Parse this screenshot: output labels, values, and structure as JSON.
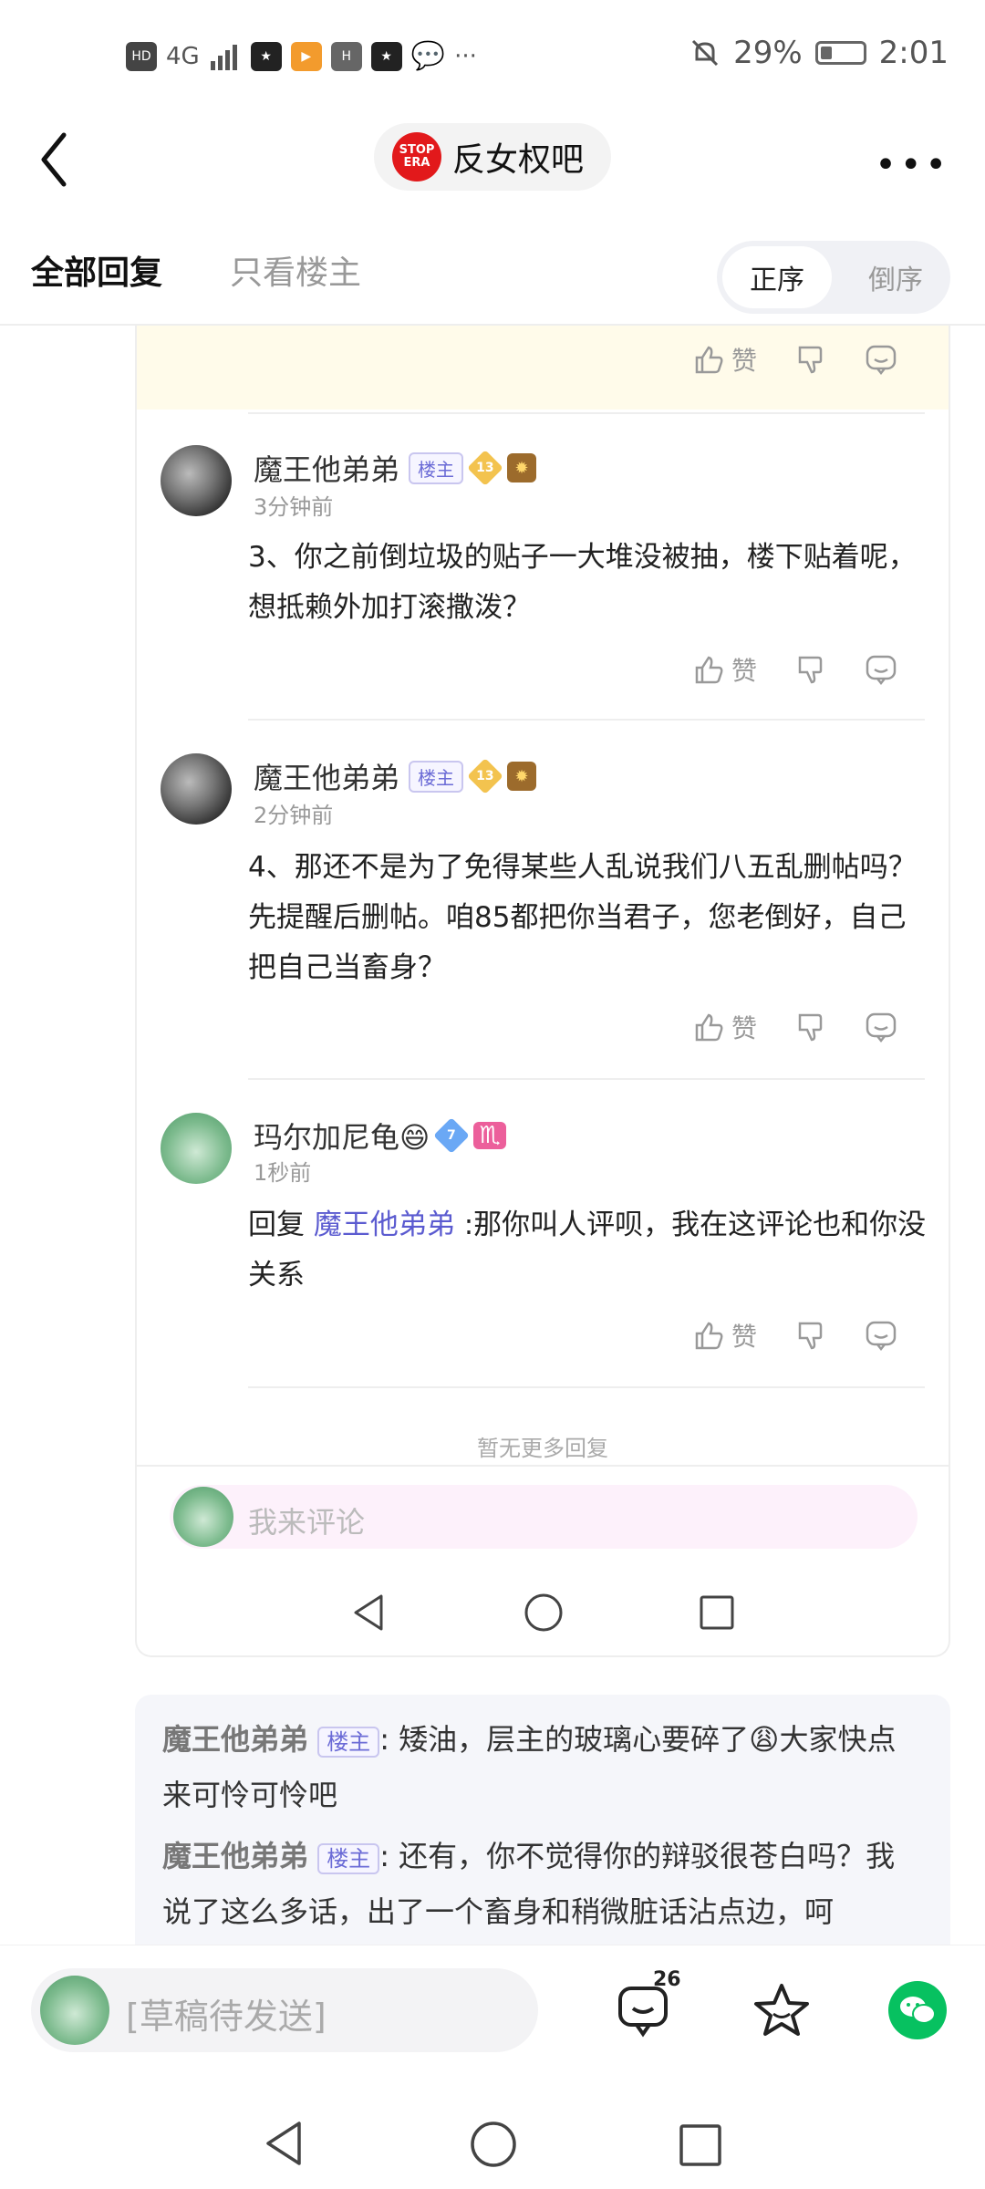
{
  "status_bar": {
    "left_text": "HD",
    "network": "4G",
    "battery_percent": "29%",
    "battery_level": 0.29,
    "time": "2:01",
    "more": "···"
  },
  "header": {
    "forum_logo_line1": "STOP",
    "forum_logo_line2": "ERA",
    "forum_name": "反女权吧",
    "more": "•••"
  },
  "tabs": {
    "all": "全部回复",
    "owner_only": "只看楼主",
    "order_asc": "正序",
    "order_desc": "倒序"
  },
  "actions": {
    "like": "赞"
  },
  "replies": [
    {
      "username": "魔王他弟弟",
      "owner_badge": "楼主",
      "level": "13",
      "time": "3分钟前",
      "content": "3、你之前倒垃圾的贴子一大堆没被抽，楼下贴着呢，想抵赖外加打滚撒泼？"
    },
    {
      "username": "魔王他弟弟",
      "owner_badge": "楼主",
      "level": "13",
      "time": "2分钟前",
      "content": "4、那还不是为了免得某些人乱说我们八五乱删帖吗？先提醒后删帖。咱85都把你当君子，您老倒好，自己把自己当畜身？"
    },
    {
      "username": "玛尔加尼龟😄",
      "level": "7",
      "zodiac": "♏",
      "time": "1秒前",
      "reply_prefix": "回复",
      "mention": "魔王他弟弟",
      "content": ":那你叫人评呗，我在这评论也和你没关系"
    }
  ],
  "no_more": "暂无更多回复",
  "comment_placeholder": "我来评论",
  "preview": [
    {
      "username": "魔王他弟弟",
      "badge": "楼主",
      "sep": ":",
      "text": "矮油，层主的玻璃心要碎了😩大家快点来可怜可怜吧"
    },
    {
      "username": "魔王他弟弟",
      "badge": "楼主",
      "sep": ":",
      "text": "还有，你不觉得你的辩驳很苍白吗？我说了这么多话，出了一个畜身和稍微脏话沾点边，呵"
    }
  ],
  "bottom_bar": {
    "draft_placeholder": "[草稿待发送]",
    "comment_count": "26"
  }
}
